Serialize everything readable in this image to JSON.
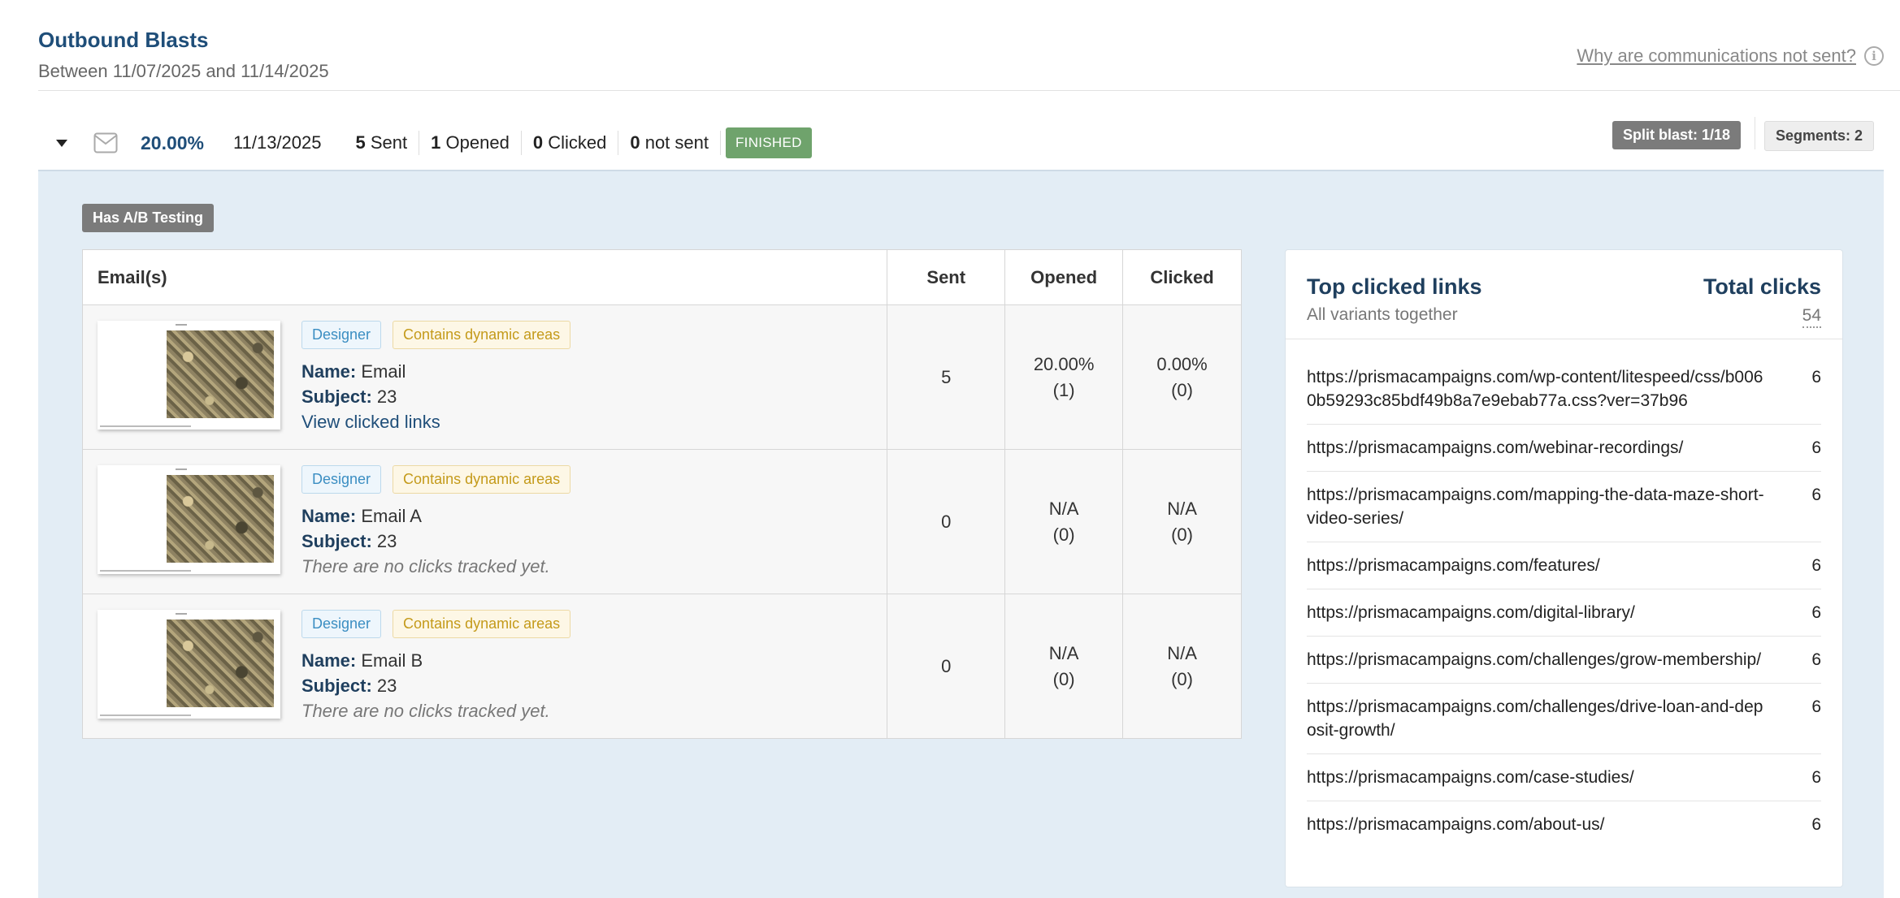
{
  "header": {
    "title": "Outbound Blasts",
    "subtitle": "Between 11/07/2025 and 11/14/2025",
    "why_link": "Why are communications not sent?"
  },
  "blast": {
    "rate": "20.00%",
    "date": "11/13/2025",
    "sent_count": "5",
    "sent_label": "Sent",
    "opened_count": "1",
    "opened_label": "Opened",
    "clicked_count": "0",
    "clicked_label": "Clicked",
    "not_sent_count": "0",
    "not_sent_label": "not sent",
    "status": "FINISHED",
    "split": "Split blast: 1/18",
    "segments": "Segments: 2",
    "status_color": "#6fa36c"
  },
  "detail": {
    "ab_badge": "Has A/B Testing",
    "table": {
      "headers": [
        "Email(s)",
        "Sent",
        "Opened",
        "Clicked"
      ],
      "rows": [
        {
          "tag_designer": "Designer",
          "tag_dynamic": "Contains dynamic areas",
          "name_label": "Name:",
          "name": "Email",
          "subject_label": "Subject:",
          "subject": "23",
          "extra": "View clicked links",
          "sent": "5",
          "opened_pct": "20.00%",
          "opened_count": "(1)",
          "clicked_pct": "0.00%",
          "clicked_count": "(0)"
        },
        {
          "tag_designer": "Designer",
          "tag_dynamic": "Contains dynamic areas",
          "name_label": "Name:",
          "name": "Email A",
          "subject_label": "Subject:",
          "subject": "23",
          "extra": "There are no clicks tracked yet.",
          "sent": "0",
          "opened_pct": "N/A",
          "opened_count": "(0)",
          "clicked_pct": "N/A",
          "clicked_count": "(0)"
        },
        {
          "tag_designer": "Designer",
          "tag_dynamic": "Contains dynamic areas",
          "name_label": "Name:",
          "name": "Email B",
          "subject_label": "Subject:",
          "subject": "23",
          "extra": "There are no clicks tracked yet.",
          "sent": "0",
          "opened_pct": "N/A",
          "opened_count": "(0)",
          "clicked_pct": "N/A",
          "clicked_count": "(0)"
        }
      ]
    },
    "links": {
      "title": "Top clicked links",
      "subtitle": "All variants together",
      "total_label": "Total clicks",
      "total": "54",
      "items": [
        {
          "url": "https://prismacampaigns.com/wp-content/litespeed/css/b0060b59293c85bdf49b8a7e9ebab77a.css?ver=37b96",
          "count": "6"
        },
        {
          "url": "https://prismacampaigns.com/webinar-recordings/",
          "count": "6"
        },
        {
          "url": "https://prismacampaigns.com/mapping-the-data-maze-short-video-series/",
          "count": "6"
        },
        {
          "url": "https://prismacampaigns.com/features/",
          "count": "6"
        },
        {
          "url": "https://prismacampaigns.com/digital-library/",
          "count": "6"
        },
        {
          "url": "https://prismacampaigns.com/challenges/grow-membership/",
          "count": "6"
        },
        {
          "url": "https://prismacampaigns.com/challenges/drive-loan-and-deposit-growth/",
          "count": "6"
        },
        {
          "url": "https://prismacampaigns.com/case-studies/",
          "count": "6"
        },
        {
          "url": "https://prismacampaigns.com/about-us/",
          "count": "6"
        }
      ]
    }
  },
  "icons": {
    "expand": "caret-down-icon",
    "email": "envelope-icon",
    "info": "info-icon"
  },
  "colors": {
    "accent": "#1f4e79",
    "panel_bg": "#e3edf5",
    "badge_grey": "#7b7b7b"
  }
}
